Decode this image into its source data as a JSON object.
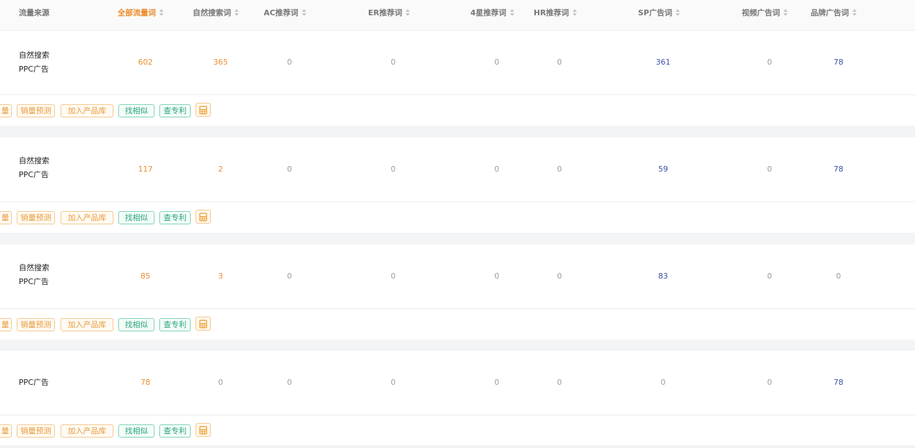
{
  "header": {
    "columns": [
      {
        "label": "流量来源",
        "sortable": false,
        "active": false
      },
      {
        "label": "全部流量词",
        "sortable": true,
        "active": true
      },
      {
        "label": "自然搜索词",
        "sortable": true,
        "active": false
      },
      {
        "label": "AC推荐词",
        "sortable": true,
        "active": false
      },
      {
        "label": "ER推荐词",
        "sortable": true,
        "active": false
      },
      {
        "label": "4星推荐词",
        "sortable": true,
        "active": false
      },
      {
        "label": "HR推荐词",
        "sortable": true,
        "active": false
      },
      {
        "label": "SP广告词",
        "sortable": true,
        "active": false
      },
      {
        "label": "视频广告词",
        "sortable": true,
        "active": false
      },
      {
        "label": "品牌广告词",
        "sortable": true,
        "active": false
      }
    ]
  },
  "actions": {
    "partial_label": "量",
    "sales_forecast": "销量预测",
    "add_to_library": "加入产品库",
    "find_similar": "找相似",
    "check_patent": "查专利",
    "calculator_icon": "calculator-icon"
  },
  "rows": [
    {
      "sources": [
        "自然搜索",
        "PPC广告"
      ],
      "all": "602",
      "organic": "365",
      "ac": "0",
      "er": "0",
      "four_star": "0",
      "hr": "0",
      "sp": "361",
      "video": "0",
      "brand": "78"
    },
    {
      "sources": [
        "自然搜索",
        "PPC广告"
      ],
      "all": "117",
      "organic": "2",
      "ac": "0",
      "er": "0",
      "four_star": "0",
      "hr": "0",
      "sp": "59",
      "video": "0",
      "brand": "78"
    },
    {
      "sources": [
        "自然搜索",
        "PPC广告"
      ],
      "all": "85",
      "organic": "3",
      "ac": "0",
      "er": "0",
      "four_star": "0",
      "hr": "0",
      "sp": "83",
      "video": "0",
      "brand": "0"
    },
    {
      "sources": [
        "PPC广告"
      ],
      "all": "78",
      "organic": "0",
      "ac": "0",
      "er": "0",
      "four_star": "0",
      "hr": "0",
      "sp": "0",
      "video": "0",
      "brand": "78"
    }
  ],
  "colors": {
    "accent_orange": "#ed8b2c",
    "value_blue": "#3a4fa8",
    "tag_green": "#29a57a",
    "separator": "#f3f4f6"
  }
}
